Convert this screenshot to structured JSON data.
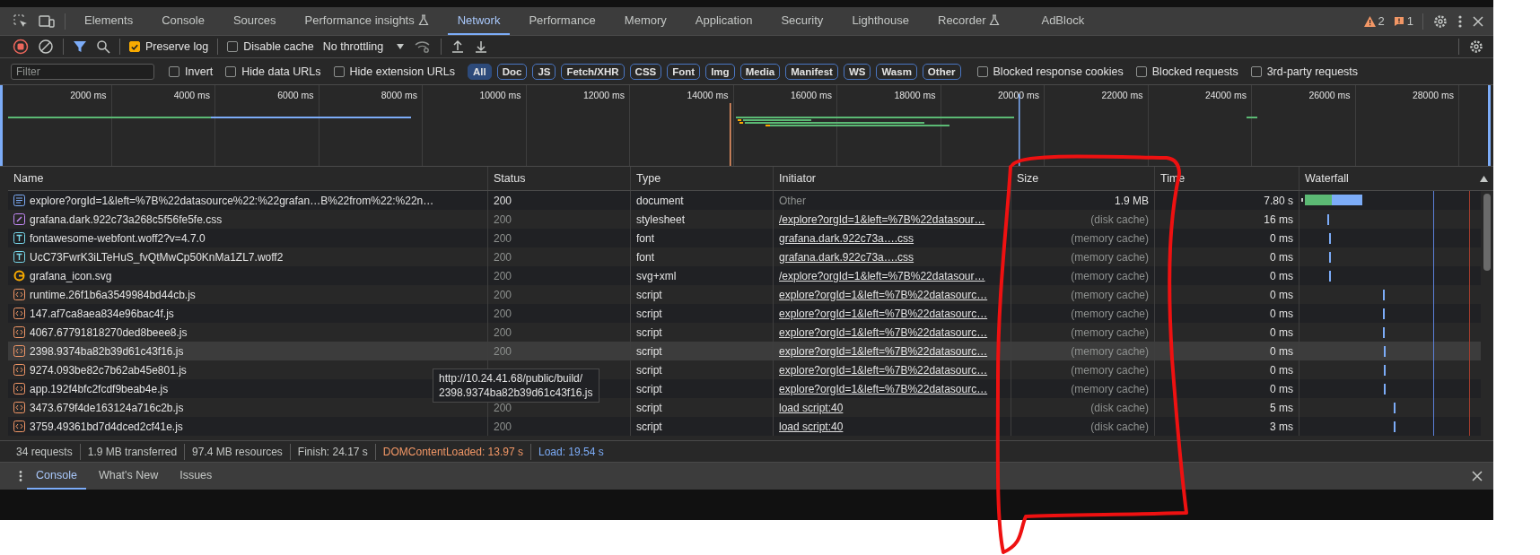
{
  "main_tabs": [
    {
      "label": "Elements",
      "selected": false,
      "experimental": false
    },
    {
      "label": "Console",
      "selected": false,
      "experimental": false
    },
    {
      "label": "Sources",
      "selected": false,
      "experimental": false
    },
    {
      "label": "Performance insights",
      "selected": false,
      "experimental": true
    },
    {
      "label": "Network",
      "selected": true,
      "experimental": false
    },
    {
      "label": "Performance",
      "selected": false,
      "experimental": false
    },
    {
      "label": "Memory",
      "selected": false,
      "experimental": false
    },
    {
      "label": "Application",
      "selected": false,
      "experimental": false
    },
    {
      "label": "Security",
      "selected": false,
      "experimental": false
    },
    {
      "label": "Lighthouse",
      "selected": false,
      "experimental": false
    },
    {
      "label": "Recorder",
      "selected": false,
      "experimental": true
    },
    {
      "label": "AdBlock",
      "selected": false,
      "experimental": false
    }
  ],
  "issue_counts": {
    "warnings": "2",
    "info": "1"
  },
  "network_toolbar": {
    "recording": true,
    "preserve_log": {
      "label": "Preserve log",
      "checked": true
    },
    "disable_cache": {
      "label": "Disable cache",
      "checked": false
    },
    "throttling": "No throttling"
  },
  "filter_bar": {
    "placeholder": "Filter",
    "options_left": [
      {
        "label": "Invert",
        "checked": false
      },
      {
        "label": "Hide data URLs",
        "checked": false
      },
      {
        "label": "Hide extension URLs",
        "checked": false
      }
    ],
    "type_filters": [
      {
        "label": "All",
        "selected": true
      },
      {
        "label": "Doc",
        "selected": false
      },
      {
        "label": "JS",
        "selected": false
      },
      {
        "label": "Fetch/XHR",
        "selected": false
      },
      {
        "label": "CSS",
        "selected": false
      },
      {
        "label": "Font",
        "selected": false
      },
      {
        "label": "Img",
        "selected": false
      },
      {
        "label": "Media",
        "selected": false
      },
      {
        "label": "Manifest",
        "selected": false
      },
      {
        "label": "WS",
        "selected": false
      },
      {
        "label": "Wasm",
        "selected": false
      },
      {
        "label": "Other",
        "selected": false
      }
    ],
    "options_right": [
      {
        "label": "Blocked response cookies",
        "checked": false
      },
      {
        "label": "Blocked requests",
        "checked": false
      },
      {
        "label": "3rd-party requests",
        "checked": false
      }
    ]
  },
  "overview_ticks": [
    "2000 ms",
    "4000 ms",
    "6000 ms",
    "8000 ms",
    "10000 ms",
    "12000 ms",
    "14000 ms",
    "16000 ms",
    "18000 ms",
    "20000 ms",
    "22000 ms",
    "24000 ms",
    "26000 ms",
    "28000 ms"
  ],
  "table": {
    "columns": [
      {
        "label": "Name",
        "sorted": false
      },
      {
        "label": "Status",
        "sorted": false
      },
      {
        "label": "Type",
        "sorted": false
      },
      {
        "label": "Initiator",
        "sorted": false
      },
      {
        "label": "Size",
        "sorted": false
      },
      {
        "label": "Time",
        "sorted": false
      },
      {
        "label": "Waterfall",
        "sorted": true
      }
    ],
    "rows": [
      {
        "kind": "document",
        "name": "explore?orgId=1&left=%7B%22datasource%22:%22grafan…B%22from%22:%22n…",
        "status": "200",
        "cached": false,
        "type": "document",
        "initiator": "Other",
        "initiator_link": false,
        "size": "1.9 MB",
        "time": "7.80 s",
        "hovered": false
      },
      {
        "kind": "stylesheet",
        "name": "grafana.dark.922c73a268c5f56fe5fe.css",
        "status": "200",
        "cached": true,
        "type": "stylesheet",
        "initiator": "/explore?orgId=1&left=%7B%22datasour…",
        "initiator_link": true,
        "size": "(disk cache)",
        "time": "16 ms",
        "hovered": false
      },
      {
        "kind": "font",
        "name": "fontawesome-webfont.woff2?v=4.7.0",
        "status": "200",
        "cached": true,
        "type": "font",
        "initiator": "grafana.dark.922c73a….css",
        "initiator_link": true,
        "size": "(memory cache)",
        "time": "0 ms",
        "hovered": false
      },
      {
        "kind": "font",
        "name": "UcC73FwrK3iLTeHuS_fvQtMwCp50KnMa1ZL7.woff2",
        "status": "200",
        "cached": true,
        "type": "font",
        "initiator": "grafana.dark.922c73a….css",
        "initiator_link": true,
        "size": "(memory cache)",
        "time": "0 ms",
        "hovered": false
      },
      {
        "kind": "image",
        "name": "grafana_icon.svg",
        "status": "200",
        "cached": true,
        "type": "svg+xml",
        "initiator": "/explore?orgId=1&left=%7B%22datasour…",
        "initiator_link": true,
        "size": "(memory cache)",
        "time": "0 ms",
        "hovered": false
      },
      {
        "kind": "script",
        "name": "runtime.26f1b6a3549984bd44cb.js",
        "status": "200",
        "cached": true,
        "type": "script",
        "initiator": "explore?orgId=1&left=%7B%22datasourc…",
        "initiator_link": true,
        "size": "(memory cache)",
        "time": "0 ms",
        "hovered": false
      },
      {
        "kind": "script",
        "name": "147.af7ca8aea834e96bac4f.js",
        "status": "200",
        "cached": true,
        "type": "script",
        "initiator": "explore?orgId=1&left=%7B%22datasourc…",
        "initiator_link": true,
        "size": "(memory cache)",
        "time": "0 ms",
        "hovered": false
      },
      {
        "kind": "script",
        "name": "4067.67791818270ded8beee8.js",
        "status": "200",
        "cached": true,
        "type": "script",
        "initiator": "explore?orgId=1&left=%7B%22datasourc…",
        "initiator_link": true,
        "size": "(memory cache)",
        "time": "0 ms",
        "hovered": false
      },
      {
        "kind": "script",
        "name": "2398.9374ba82b39d61c43f16.js",
        "status": "200",
        "cached": true,
        "type": "script",
        "initiator": "explore?orgId=1&left=%7B%22datasourc…",
        "initiator_link": true,
        "size": "(memory cache)",
        "time": "0 ms",
        "hovered": true
      },
      {
        "kind": "script",
        "name": "9274.093be82c7b62ab45e801.js",
        "cached": true,
        "type": "script",
        "initiator": "explore?orgId=1&left=%7B%22datasourc…",
        "initiator_link": true,
        "size": "(memory cache)",
        "time": "0 ms",
        "hovered": false
      },
      {
        "kind": "script",
        "name": "app.192f4bfc2fcdf9beab4e.js",
        "cached": true,
        "type": "script",
        "initiator": "explore?orgId=1&left=%7B%22datasourc…",
        "initiator_link": true,
        "size": "(memory cache)",
        "time": "0 ms",
        "hovered": false
      },
      {
        "kind": "script",
        "name": "3473.679f4de163124a716c2b.js",
        "status": "200",
        "cached": true,
        "type": "script",
        "initiator": "load script:40",
        "initiator_link": true,
        "size": "(disk cache)",
        "time": "5 ms",
        "hovered": false
      },
      {
        "kind": "script",
        "name": "3759.49361bd7d4dced2cf41e.js",
        "status": "200",
        "cached": true,
        "type": "script",
        "initiator": "load script:40",
        "initiator_link": true,
        "size": "(disk cache)",
        "time": "3 ms",
        "hovered": false
      }
    ]
  },
  "tooltip": {
    "lines": [
      "http://10.24.41.68/public/build/",
      "2398.9374ba82b39d61c43f16.js"
    ]
  },
  "status_bar": [
    {
      "kind": "plain",
      "text": "34 requests"
    },
    {
      "kind": "plain",
      "text": "1.9 MB transferred"
    },
    {
      "kind": "plain",
      "text": "97.4 MB resources"
    },
    {
      "kind": "plain",
      "text": "Finish: 24.17 s"
    },
    {
      "kind": "dom",
      "text": "DOMContentLoaded: 13.97 s"
    },
    {
      "kind": "load",
      "text": "Load: 19.54 s"
    }
  ],
  "drawer_tabs": [
    {
      "label": "Console",
      "selected": true
    },
    {
      "label": "What's New",
      "selected": false
    },
    {
      "label": "Issues",
      "selected": false
    }
  ]
}
